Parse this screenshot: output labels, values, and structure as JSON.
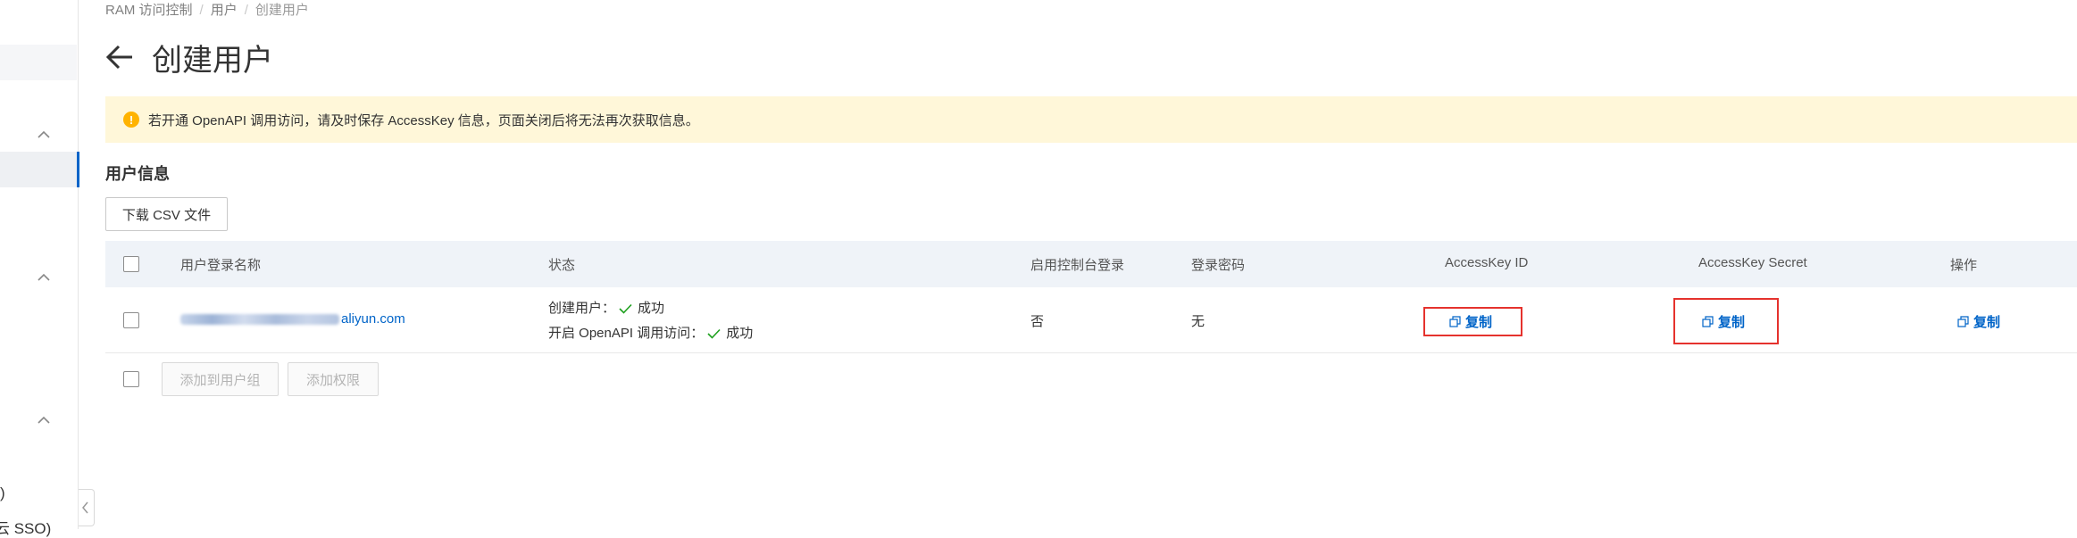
{
  "sidebar": {
    "text_items": [
      ")",
      "云 SSO)"
    ]
  },
  "breadcrumb": [
    "RAM 访问控制",
    "用户",
    "创建用户"
  ],
  "page_title": "创建用户",
  "alert": {
    "text": "若开通 OpenAPI 调用访问，请及时保存 AccessKey 信息，页面关闭后将无法再次获取信息。",
    "color": "#fff7d9"
  },
  "section_title": "用户信息",
  "download_button": "下载 CSV 文件",
  "table": {
    "headers": [
      "用户登录名称",
      "状态",
      "启用控制台登录",
      "登录密码",
      "AccessKey ID",
      "AccessKey Secret",
      "操作"
    ],
    "rows": [
      {
        "login_name_suffix": "aliyun.com",
        "status_line1_label": "创建用户：",
        "status_line1_value": "成功",
        "status_line2_label": "开启 OpenAPI 调用访问：",
        "status_line2_value": "成功",
        "console_login": "否",
        "password": "无",
        "ak_id_action": "复制",
        "ak_secret_action": "复制",
        "operation": "复制"
      }
    ]
  },
  "footer_buttons": [
    "添加到用户组",
    "添加权限"
  ],
  "colors": {
    "primary": "#0064c8",
    "success": "#1ea01e",
    "highlight": "#e5322d",
    "warning": "#ffb300"
  }
}
